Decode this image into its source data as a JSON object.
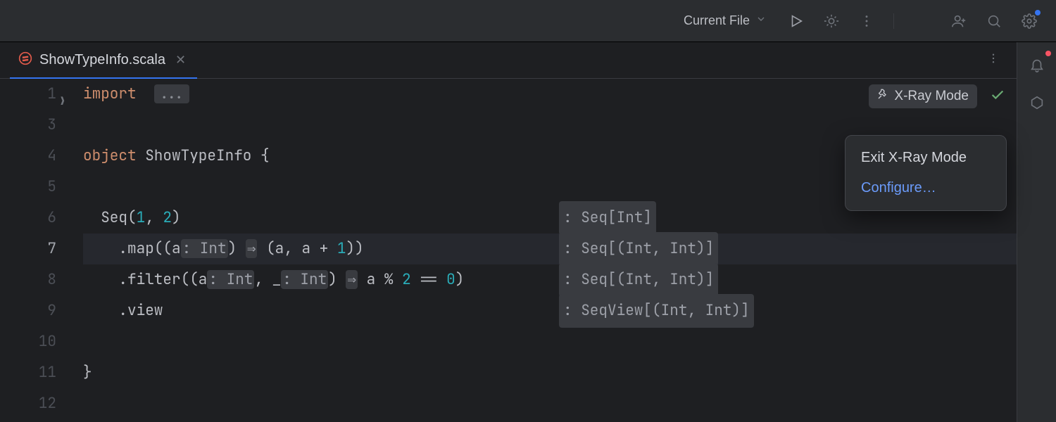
{
  "toolbar": {
    "run_config_label": "Current File"
  },
  "tab": {
    "filename": "ShowTypeInfo.scala"
  },
  "xray": {
    "badge_label": "X-Ray Mode",
    "popup_exit": "Exit X-Ray Mode",
    "popup_configure": "Configure…"
  },
  "gutter": {
    "lines": [
      "1",
      "3",
      "4",
      "5",
      "6",
      "7",
      "8",
      "9",
      "10",
      "11",
      "12"
    ]
  },
  "code": {
    "line1_kw": "import",
    "line1_fold": "...",
    "line4_kw": "object",
    "line4_rest": " ShowTypeInfo {",
    "line6_pre": "  Seq(",
    "line6_n1": "1",
    "line6_mid": ", ",
    "line6_n2": "2",
    "line6_post": ")",
    "line7_pre": "    .map((a",
    "line7_p1": ": Int",
    "line7_mid1": ") ",
    "line7_arrow": "⇒",
    "line7_mid2": " (a, a + ",
    "line7_n1": "1",
    "line7_post": "))",
    "line8_pre": "    .filter((a",
    "line8_p1": ": Int",
    "line8_mid1": ", _",
    "line8_p2": ": Int",
    "line8_mid2": ") ",
    "line8_arrow": "⇒",
    "line8_mid3": " a % ",
    "line8_n1": "2",
    "line8_mid4": " == ",
    "line8_n2": "0",
    "line8_post": ")",
    "line9": "    .view",
    "line11": "}"
  },
  "hints": {
    "h6": ": Seq[Int]",
    "h7": ": Seq[(Int, Int)]",
    "h8": ": Seq[(Int, Int)]",
    "h9": ": SeqView[(Int, Int)]"
  }
}
